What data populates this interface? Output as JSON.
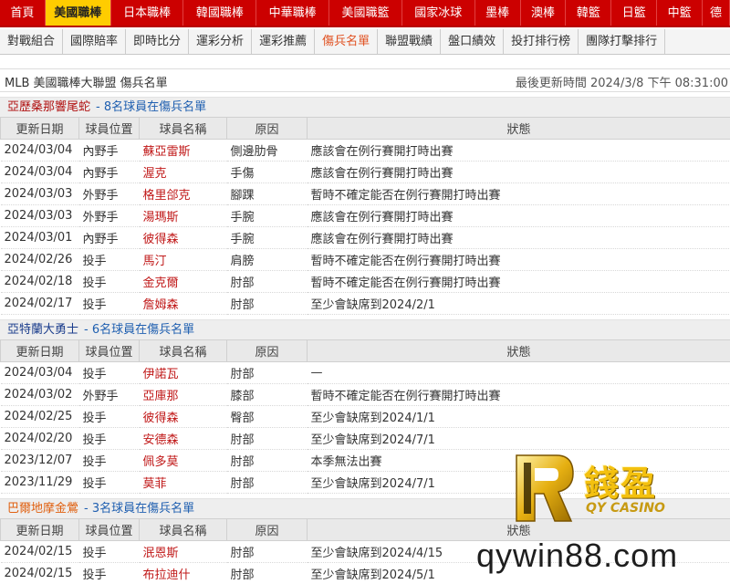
{
  "topnav": [
    "首頁",
    "美國職棒",
    "日本職棒",
    "韓國職棒",
    "中華職棒",
    "美國職籃",
    "國家冰球",
    "墨棒",
    "澳棒",
    "韓籃",
    "日籃",
    "中籃",
    "德"
  ],
  "subnav": [
    "對戰組合",
    "國際賠率",
    "即時比分",
    "運彩分析",
    "運彩推薦",
    "傷兵名單",
    "聯盟戰績",
    "盤口績效",
    "投打排行榜",
    "團隊打擊排行"
  ],
  "page": {
    "title": "MLB 美國職棒大聯盟 傷兵名單",
    "updated": "最後更新時間 2024/3/8 下午 08:31:00"
  },
  "columns": [
    "更新日期",
    "球員位置",
    "球員名稱",
    "原因",
    "狀態"
  ],
  "teams": [
    {
      "name": "亞歷桑那響尾蛇",
      "count": "- 8名球員在傷兵名單",
      "rows": [
        [
          "2024/03/04",
          "內野手",
          "蘇亞雷斯",
          "側邊肋骨",
          "應該會在例行賽開打時出賽"
        ],
        [
          "2024/03/04",
          "內野手",
          "渥克",
          "手傷",
          "應該會在例行賽開打時出賽"
        ],
        [
          "2024/03/03",
          "外野手",
          "格里郃克",
          "腳踝",
          "暫時不確定能否在例行賽開打時出賽"
        ],
        [
          "2024/03/03",
          "外野手",
          "湯瑪斯",
          "手腕",
          "應該會在例行賽開打時出賽"
        ],
        [
          "2024/03/01",
          "內野手",
          "彼得森",
          "手腕",
          "應該會在例行賽開打時出賽"
        ],
        [
          "2024/02/26",
          "投手",
          "馬汀",
          "肩膀",
          "暫時不確定能否在例行賽開打時出賽"
        ],
        [
          "2024/02/18",
          "投手",
          "金克爾",
          "肘部",
          "暫時不確定能否在例行賽開打時出賽"
        ],
        [
          "2024/02/17",
          "投手",
          "詹姆森",
          "肘部",
          "至少會缺席到2024/2/1"
        ]
      ]
    },
    {
      "name": "亞特蘭大勇士",
      "count": "- 6名球員在傷兵名單",
      "rows": [
        [
          "2024/03/04",
          "投手",
          "伊諾瓦",
          "肘部",
          "—"
        ],
        [
          "2024/03/02",
          "外野手",
          "亞庫那",
          "膝部",
          "暫時不確定能否在例行賽開打時出賽"
        ],
        [
          "2024/02/25",
          "投手",
          "彼得森",
          "臀部",
          "至少會缺席到2024/1/1"
        ],
        [
          "2024/02/20",
          "投手",
          "安德森",
          "肘部",
          "至少會缺席到2024/7/1"
        ],
        [
          "2023/12/07",
          "投手",
          "佩多莫",
          "肘部",
          "本季無法出賽"
        ],
        [
          "2023/11/29",
          "投手",
          "莫菲",
          "肘部",
          "至少會缺席到2024/7/1"
        ]
      ]
    },
    {
      "name": "巴爾地摩金鶯",
      "count": "- 3名球員在傷兵名單",
      "rows": [
        [
          "2024/02/15",
          "投手",
          "泯恩斯",
          "肘部",
          "至少會缺席到2024/4/15"
        ],
        [
          "2024/02/15",
          "投手",
          "布拉迪什",
          "肘部",
          "至少會缺席到2024/5/1"
        ]
      ]
    }
  ],
  "watermark": {
    "brand": "錢盈",
    "sub": "QY CASINO",
    "site": "qywin88.com",
    "gold": "#f4c10f"
  },
  "colors": {
    "nav_red": "#cc0000",
    "nav_active": "#ffcc00",
    "name_red": "#c01818"
  }
}
